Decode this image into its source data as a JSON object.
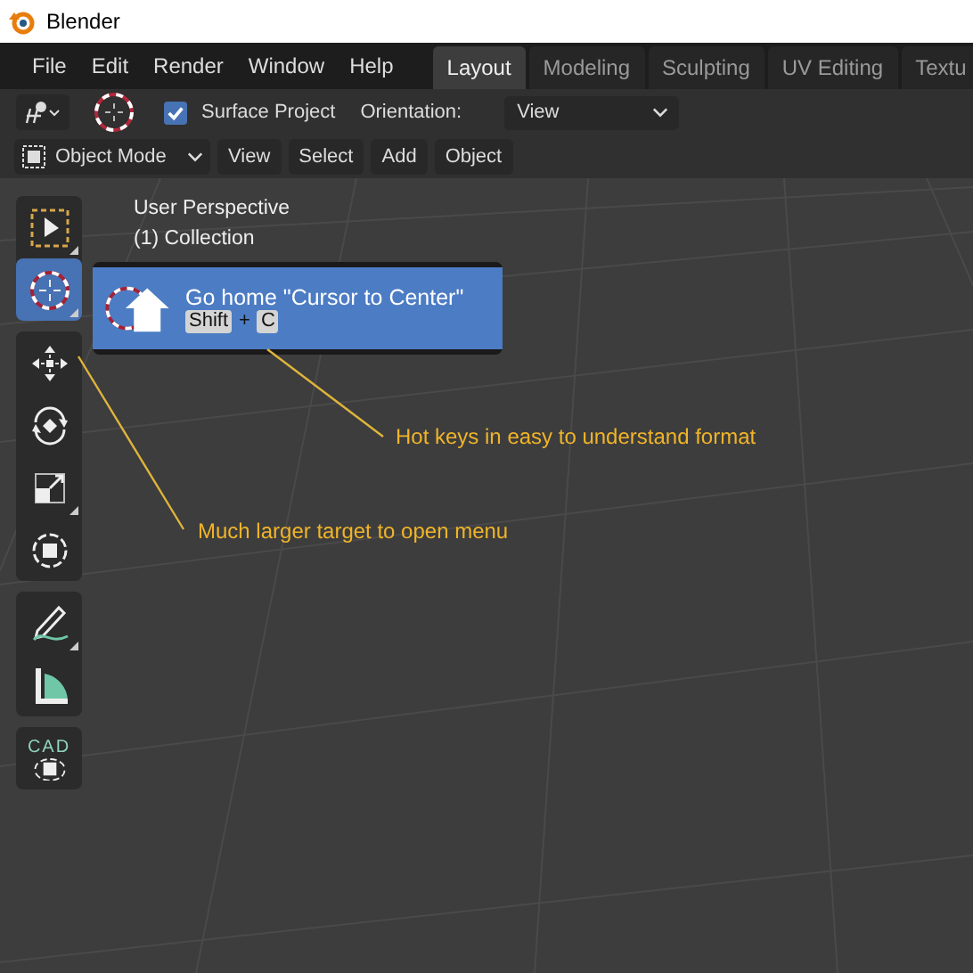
{
  "window": {
    "title": "Blender"
  },
  "menu": [
    "File",
    "Edit",
    "Render",
    "Window",
    "Help"
  ],
  "workspace_tabs": [
    {
      "label": "Layout",
      "selected": true
    },
    {
      "label": "Modeling",
      "selected": false
    },
    {
      "label": "Sculpting",
      "selected": false
    },
    {
      "label": "UV Editing",
      "selected": false
    },
    {
      "label": "Textu",
      "selected": false
    }
  ],
  "tool_header": {
    "surface_project": {
      "label": "Surface Project",
      "checked": true
    },
    "orientation": {
      "label": "Orientation:",
      "value": "View"
    }
  },
  "viewport_header": {
    "mode": "Object Mode",
    "menus": [
      "View",
      "Select",
      "Add",
      "Object"
    ]
  },
  "viewport": {
    "overlay_text": [
      "User Perspective",
      "(1) Collection"
    ]
  },
  "toolbar_groups": [
    {
      "tools": [
        {
          "kind": "select",
          "selected": false
        },
        {
          "kind": "cursor",
          "selected": true
        }
      ]
    },
    {
      "tools": [
        {
          "kind": "move",
          "selected": false
        },
        {
          "kind": "rotate",
          "selected": false
        },
        {
          "kind": "scale",
          "selected": false
        },
        {
          "kind": "transform",
          "selected": false
        }
      ]
    },
    {
      "tools": [
        {
          "kind": "annotate",
          "selected": false
        },
        {
          "kind": "measure",
          "selected": false
        }
      ]
    },
    {
      "tools": [
        {
          "kind": "cad",
          "label": "CAD",
          "selected": false
        }
      ]
    }
  ],
  "tooltip": {
    "title": "Go home \"Cursor to Center\"",
    "keys": [
      "Shift",
      "C"
    ],
    "joiner": "+"
  },
  "annotations": [
    {
      "text": "Hot keys in easy to understand format"
    },
    {
      "text": "Much larger target to open menu"
    }
  ]
}
